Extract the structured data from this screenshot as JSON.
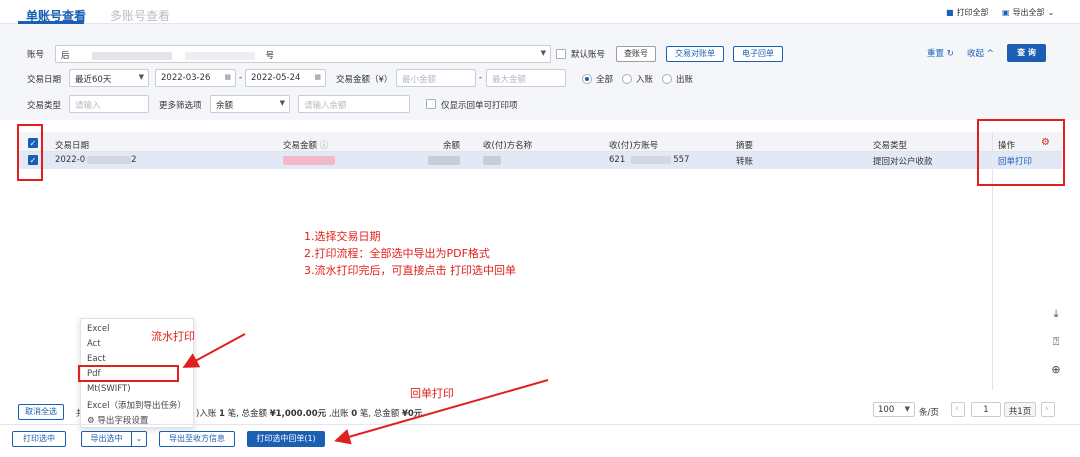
{
  "tabs": [
    {
      "label": "单账号查看",
      "active": true
    },
    {
      "label": "多账号查看",
      "active": false
    }
  ],
  "header_actions": {
    "print_all": "打印全部",
    "export_all": "导出全部"
  },
  "filters": {
    "account_label": "账号",
    "account_value_prefix": "后",
    "account_value_suffix": "号",
    "default_account": "默认账号",
    "buttons": [
      "查账号",
      "交易对账单",
      "电子回单"
    ],
    "reset": "重置",
    "collapse": "收起",
    "query": "查 询",
    "date_label": "交易日期",
    "date_range_option": "最近60天",
    "date_start": "2022-03-26",
    "date_end": "2022-05-24",
    "date_sep": "-",
    "amount_label": "交易金额（¥）",
    "amount_min_placeholder": "最小金额",
    "amount_max_placeholder": "最大金额",
    "direction": [
      "全部",
      "入账",
      "出账"
    ],
    "type_label": "交易类型",
    "type_placeholder": "请输入",
    "more_label": "更多筛选项",
    "more_value": "余额",
    "balance_placeholder": "请输入余额",
    "only_printable": "仅显示回单可打印项"
  },
  "table": {
    "columns": [
      "交易日期",
      "交易金额",
      "余额",
      "收(付)方名称",
      "收(付)方账号",
      "摘要",
      "交易类型",
      "操作"
    ],
    "rows": [
      {
        "date": "2022-0",
        "date_tail": "2",
        "account_prefix": "621",
        "account_suffix": "557",
        "summary": "转账",
        "type": "提回对公户收款",
        "action": "回单打印"
      }
    ]
  },
  "annotations": {
    "steps": [
      "1.选择交易日期",
      "2.打印流程：全部选中导出为PDF格式",
      "3.流水打印完后，可直接点击  打印选中回单"
    ],
    "flow_print": "流水打印",
    "receipt_print": "回单打印"
  },
  "export_menu": {
    "items": [
      "Excel",
      "Act",
      "Eact",
      "Pdf",
      "Mt(SWIFT)",
      "Excel（添加到导出任务）"
    ],
    "settings": "导出字段设置"
  },
  "summary": {
    "deselect_all": "取消全选",
    "prefix": "共",
    "text_a": ")入账 ",
    "count_in": "1",
    "text_b": " 笔, 总金额 ",
    "amount_in": "¥1,000.00元",
    "text_c": " ,出账 ",
    "count_out": "0",
    "text_d": " 笔, 总金额 ",
    "amount_out": "¥0元"
  },
  "pagination": {
    "page_size": "100",
    "per_page": "条/页",
    "page": "1",
    "total_pages": "共1页"
  },
  "footer": {
    "print_selected": "打印选中",
    "export_selected": "导出选中",
    "export_payee": "导出至收方信息",
    "print_receipts": "打印选中回单(1)"
  }
}
